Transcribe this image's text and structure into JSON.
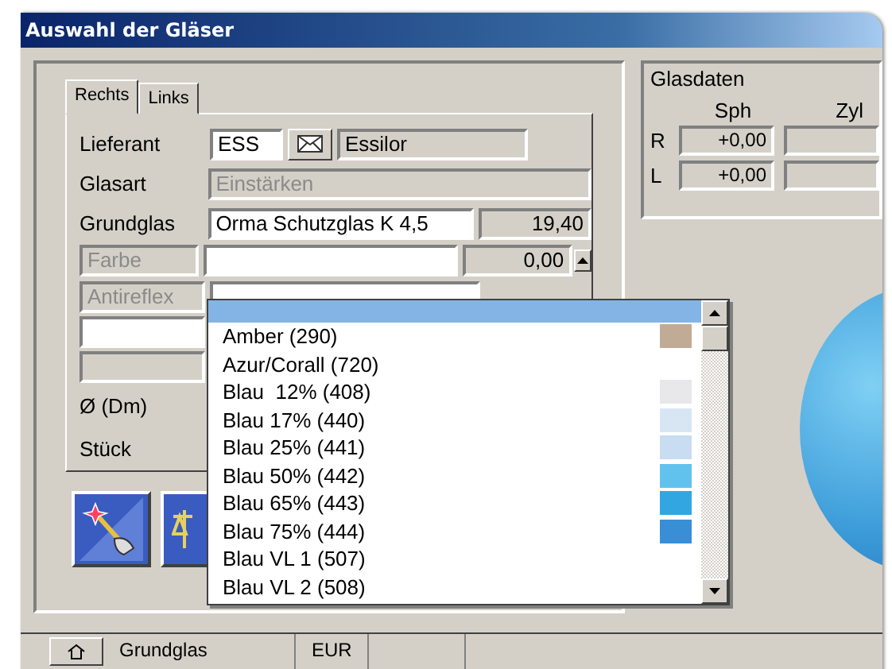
{
  "window": {
    "title": "Auswahl der Gläser"
  },
  "tabs": [
    {
      "label": "Rechts",
      "selected": true
    },
    {
      "label": "Links",
      "selected": false
    }
  ],
  "form": [
    {
      "kind": "lookup",
      "label": "Lieferant",
      "code": "ESS",
      "name": "Essilor"
    },
    {
      "kind": "readonly",
      "label": "Glasart",
      "value": "Einstärken"
    },
    {
      "kind": "priced",
      "label": "Grundglas",
      "value": "Orma Schutzglas K 4,5",
      "price": "19,40"
    },
    {
      "kind": "boxed",
      "label": "Farbe",
      "price": "0,00"
    },
    {
      "kind": "boxed",
      "label": "Antireflex"
    },
    {
      "kind": "blank"
    },
    {
      "kind": "greyed"
    },
    {
      "kind": "plain",
      "label": "Ø (Dm)"
    },
    {
      "kind": "plain",
      "label": "Stück"
    }
  ],
  "glasdaten": {
    "title": "Glasdaten",
    "columns": [
      "Sph",
      "Zyl"
    ],
    "rows": [
      {
        "label": "R",
        "sph": "+0,00"
      },
      {
        "label": "L",
        "sph": "+0,00"
      }
    ]
  },
  "dropdown": {
    "empty_entry": {
      "selected": true
    },
    "items": [
      {
        "label": "Amber (290)",
        "color": "#c2ab95"
      },
      {
        "label": "Azur/Corall (720)"
      },
      {
        "label": "Blau  12% (408)",
        "color": "#e8e8ea"
      },
      {
        "label": "Blau 17% (440)",
        "color": "#d8e6f4"
      },
      {
        "label": "Blau 25% (441)",
        "color": "#c8dcf2"
      },
      {
        "label": "Blau 50% (442)",
        "color": "#62c2ee"
      },
      {
        "label": "Blau 65% (443)",
        "color": "#32a6e0"
      },
      {
        "label": "Blau 75% (444)",
        "color": "#3a8ed6"
      },
      {
        "label": "Blau VL 1 (507)"
      },
      {
        "label": "Blau VL 2 (508)"
      }
    ]
  },
  "status_bar": [
    "Grundglas",
    "EUR"
  ]
}
